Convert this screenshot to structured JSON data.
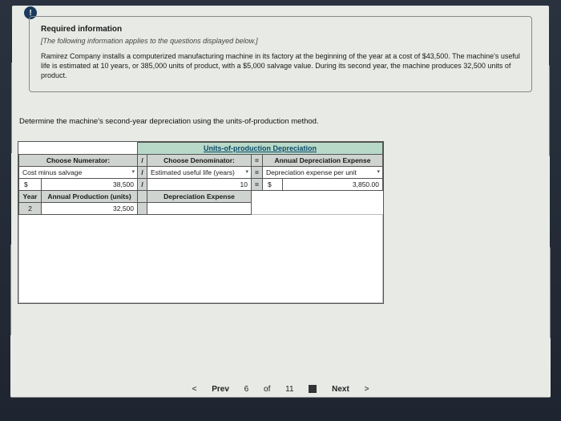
{
  "icon": "!",
  "info": {
    "title": "Required information",
    "subtitle": "[The following information applies to the questions displayed below.]",
    "body": "Ramirez Company installs a computerized manufacturing machine in its factory at the beginning of the year at a cost of $43,500. The machine's useful life is estimated at 10 years, or 385,000 units of product, with a $5,000 salvage value. During its second year, the machine produces 32,500 units of product."
  },
  "question": "Determine the machine's second-year depreciation using the units-of-production method.",
  "table": {
    "mainHeader": "Units-of-production Depreciation",
    "h_numerator": "Choose Numerator:",
    "h_op1": "/",
    "h_denominator": "Choose Denominator:",
    "h_eq": "=",
    "h_result": "Annual Depreciation Expense",
    "r1_num": "Cost minus salvage",
    "r1_op": "/",
    "r1_den": "Estimated useful life (years)",
    "r1_eq": "=",
    "r1_res": "Depreciation expense per unit",
    "r2_sym": "$",
    "r2_num": "38,500",
    "r2_op": "/",
    "r2_den": "10",
    "r2_eq": "=",
    "r2_ressym": "$",
    "r2_res": "3,850.00",
    "h_year": "Year",
    "h_prod": "Annual Production (units)",
    "h_depexp": "Depreciation Expense",
    "r3_year": "2",
    "r3_prod": "32,500"
  },
  "nav": {
    "prev": "Prev",
    "pos": "6",
    "of": "of",
    "total": "11",
    "next": "Next"
  }
}
